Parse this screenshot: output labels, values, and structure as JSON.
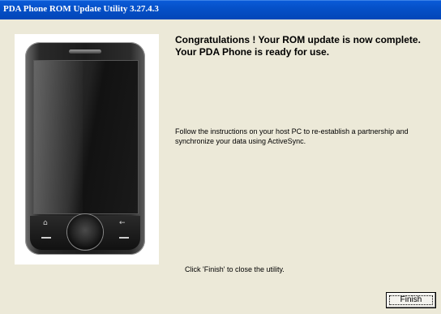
{
  "window": {
    "title": "PDA Phone ROM Update Utility 3.27.4.3"
  },
  "content": {
    "congrats": "Congratulations ! Your ROM update is now complete. Your PDA Phone is ready for use.",
    "instructions": "Follow the instructions on your host PC to re-establish a partnership and synchronize your data using ActiveSync.",
    "close_hint": "Click 'Finish' to close the utility."
  },
  "buttons": {
    "finish": "Finish"
  },
  "colors": {
    "titlebar": "#0550c8",
    "dialog_bg": "#ece9d8"
  },
  "icons": {
    "phone_image": "pda-phone-image"
  }
}
